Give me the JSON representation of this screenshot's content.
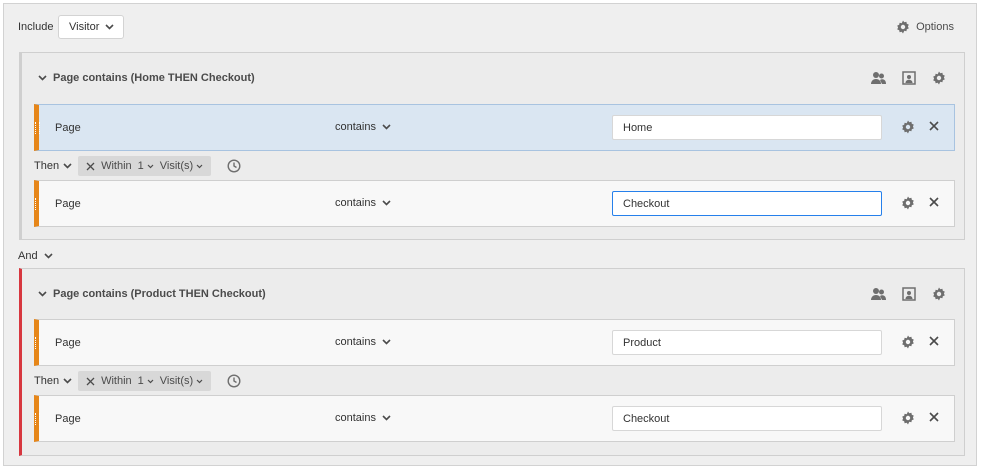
{
  "header": {
    "include_label": "Include",
    "include_value": "Visitor",
    "options_label": "Options"
  },
  "containers": [
    {
      "title": "Page contains (Home THEN Checkout)",
      "border_color": "#cfcfcf",
      "rules": [
        {
          "dimension": "Page",
          "operator": "contains",
          "value": "Home"
        },
        {
          "dimension": "Page",
          "operator": "contains",
          "value": "Checkout"
        }
      ],
      "then": {
        "label": "Then",
        "within_label": "Within",
        "count": "1",
        "unit": "Visit(s)"
      }
    },
    {
      "title": "Page contains (Product THEN Checkout)",
      "border_color": "#d7373f",
      "rules": [
        {
          "dimension": "Page",
          "operator": "contains",
          "value": "Product"
        },
        {
          "dimension": "Page",
          "operator": "contains",
          "value": "Checkout"
        }
      ],
      "then": {
        "label": "Then",
        "within_label": "Within",
        "count": "1",
        "unit": "Visit(s)"
      }
    }
  ],
  "and_label": "And",
  "icons": {
    "options": "gear-icon",
    "container_actions": [
      "users-icon",
      "presentation-icon",
      "gear-icon"
    ],
    "rule_actions": [
      "gear-icon",
      "close-icon"
    ],
    "then_extra": "clock-icon"
  },
  "colors": {
    "accent_orange": "#e68619",
    "selected_rule_bg": "#dae6f2",
    "exclude_red": "#d7373f",
    "focus_blue": "#2680eb"
  }
}
